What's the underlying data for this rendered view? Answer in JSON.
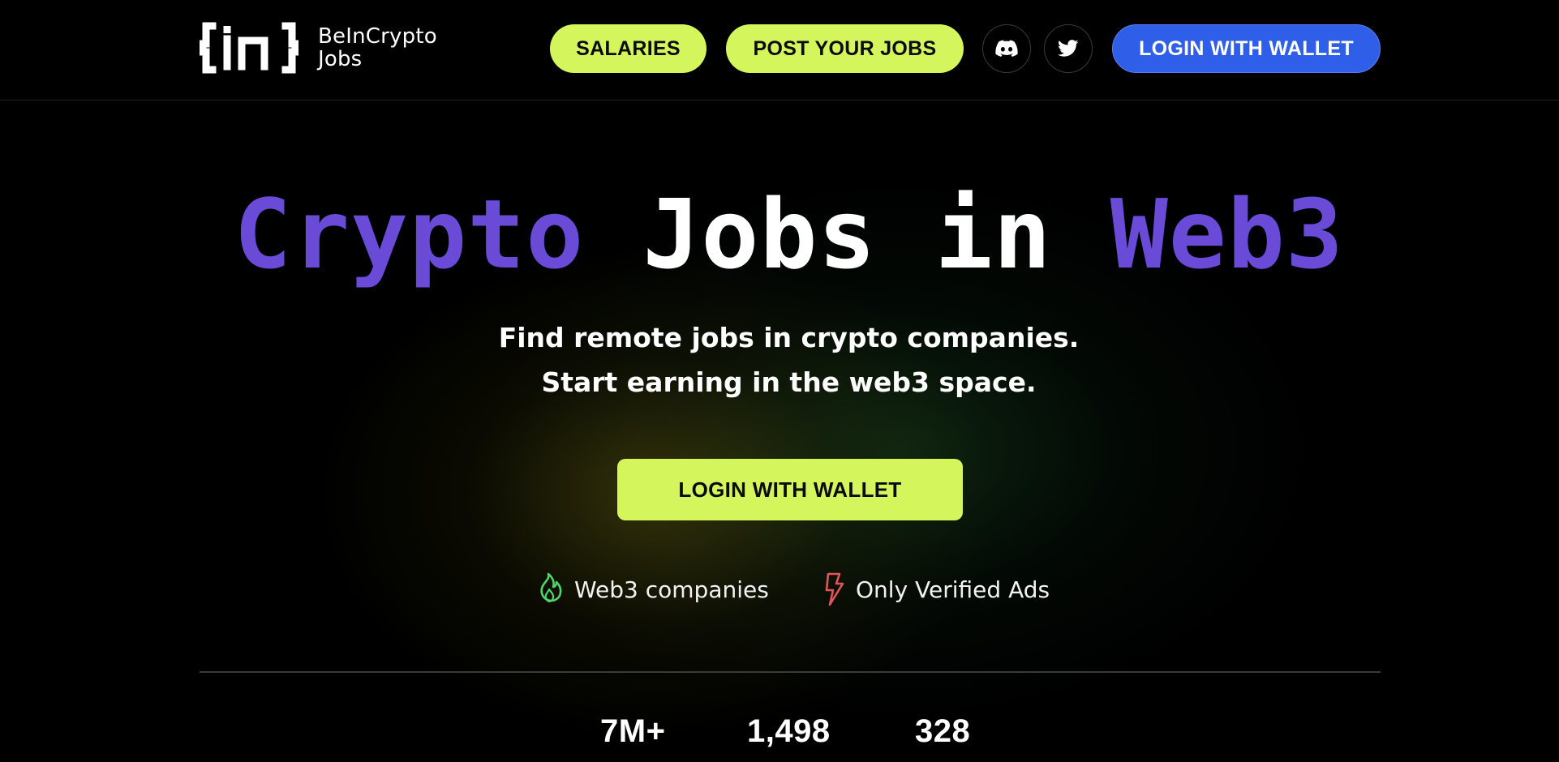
{
  "header": {
    "logo": {
      "line1": "BeInCrypto",
      "line2": "Jobs"
    },
    "nav": {
      "salaries_label": "SALARIES",
      "post_jobs_label": "POST YOUR JOBS",
      "login_label": "LOGIN WITH WALLET"
    },
    "social": [
      "discord-icon",
      "twitter-icon"
    ]
  },
  "hero": {
    "title_word1": "Crypto",
    "title_word2": "Jobs in",
    "title_word3": "Web3",
    "subtitle_line1": "Find remote jobs in crypto companies.",
    "subtitle_line2": "Start earning in the web3 space.",
    "cta_label": "LOGIN WITH WALLET",
    "features": [
      {
        "label": "Web3 companies",
        "icon": "flame-icon"
      },
      {
        "label": "Only Verified Ads",
        "icon": "lightning-icon"
      }
    ]
  },
  "stats": [
    "7M+",
    "1,498",
    "328"
  ],
  "colors": {
    "accent_lime": "#d4f65c",
    "accent_purple": "#6a4bd8",
    "accent_blue": "#2f5ee8",
    "background": "#000000"
  }
}
